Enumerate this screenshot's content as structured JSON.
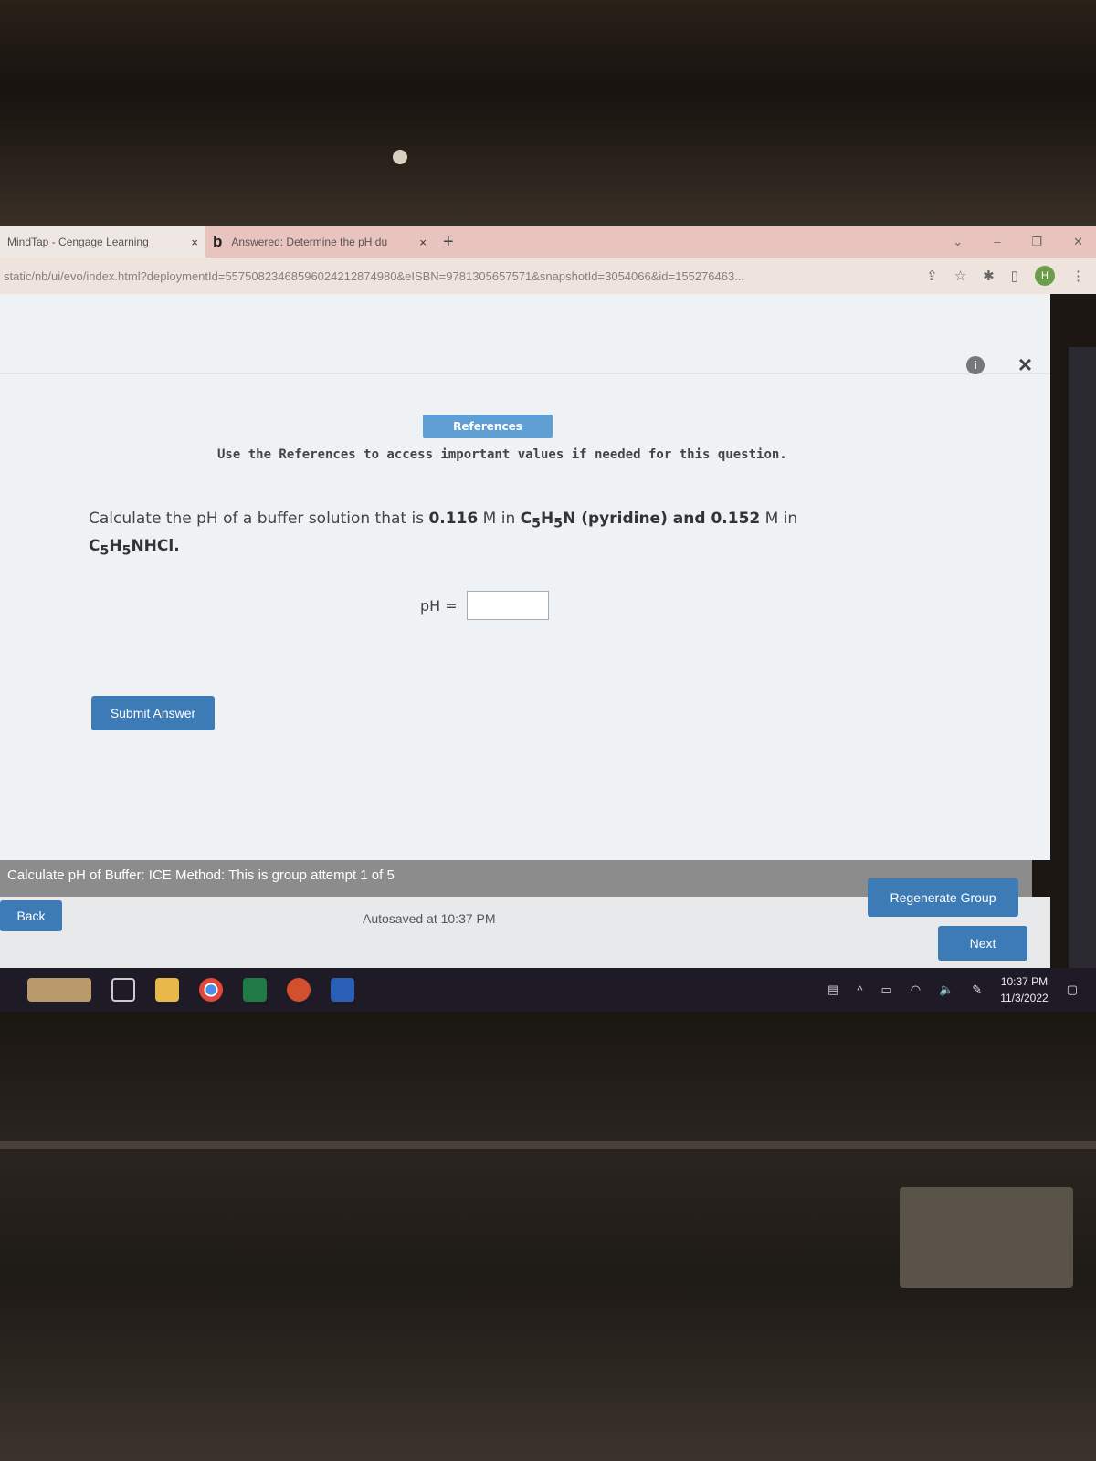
{
  "browser": {
    "tabs": [
      {
        "label": "MindTap - Cengage Learning",
        "close": "×",
        "active": true
      },
      {
        "label": "Answered: Determine the pH du",
        "close": "×",
        "icon": "b"
      }
    ],
    "new_tab": "+",
    "url": "static/nb/ui/evo/index.html?deploymentId=55750823468596024212874980&eISBN=9781305657571&snapshotId=3054066&id=155276463...",
    "profile_initial": "H"
  },
  "page": {
    "info_icon": "i",
    "close_icon": "×",
    "references_button": "References",
    "references_note": "Use the References to access important values if needed for this question.",
    "question_pre": "Calculate the pH of a buffer solution that is ",
    "conc1": "0.116",
    "unit1": " M in ",
    "species1": "C5H5N",
    "species1_name": " (pyridine) and ",
    "conc2": "0.152",
    "unit2": " M in",
    "species2": "C5H5NHCl.",
    "ph_label": "pH =",
    "ph_value": "",
    "submit_button": "Submit Answer"
  },
  "footer": {
    "group_text": "Calculate pH of Buffer: ICE Method: This is group attempt 1 of 5",
    "back_button": "Back",
    "autosave": "Autosaved at 10:37 PM",
    "regenerate_button": "Regenerate Group",
    "next_button": "Next"
  },
  "taskbar": {
    "time": "10:37 PM",
    "date": "11/3/2022",
    "apps": [
      "task-view",
      "file-explorer",
      "chrome",
      "excel",
      "powerpoint",
      "word"
    ]
  },
  "colors": {
    "accent": "#3d7bb7",
    "references": "#5f9fd4",
    "group_bar": "#8c8c8c"
  }
}
